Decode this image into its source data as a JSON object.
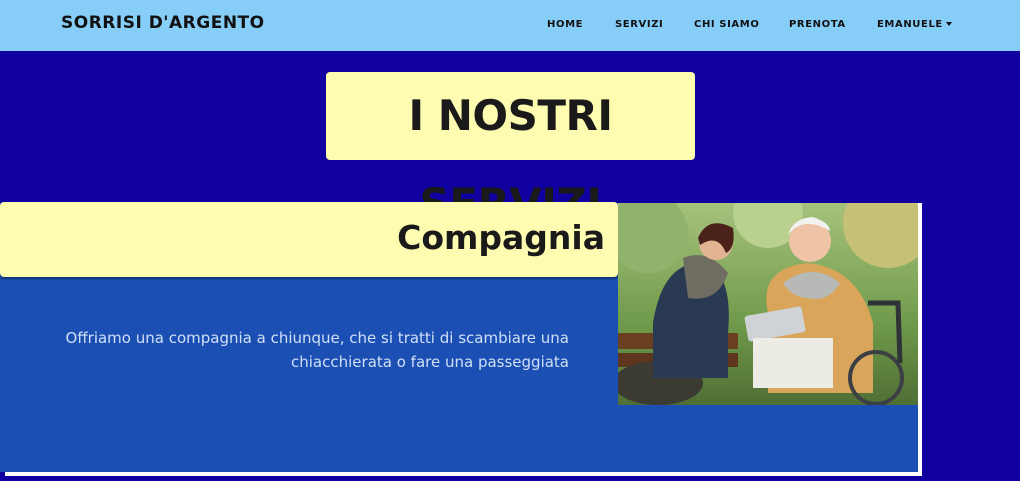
{
  "brand": "SORRISI D'ARGENTO",
  "nav": {
    "home": "HOME",
    "servizi": "SERVIZI",
    "chi_siamo": "CHI SIAMO",
    "prenota": "PRENOTA",
    "user": "EMANUELE"
  },
  "page_title": "I NOSTRI SERVIZI",
  "service": {
    "title": "Compagnia",
    "description": "Offriamo una compagnia a chiunque, che si tratti di scambiare una chiacchierata o fare una passeggiata"
  },
  "colors": {
    "navbar": "#86cdf8",
    "background": "#1100a0",
    "highlight": "#fdfcb0",
    "card": "#1c4fb3"
  }
}
